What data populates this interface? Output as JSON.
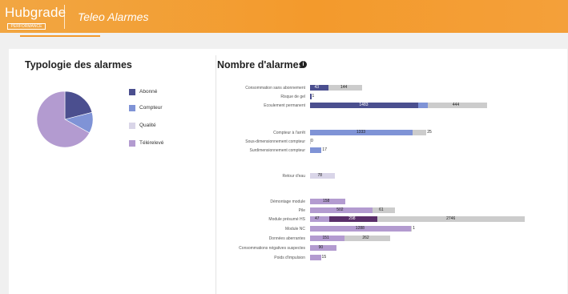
{
  "header": {
    "logo_text": "Hubgrade",
    "logo_subtitle": "PERFORMANCE",
    "app_title": "Teleo Alarmes"
  },
  "typology": {
    "title": "Typologie des alarmes",
    "legend": [
      {
        "label": "Abonné",
        "color": "#4b4f8f"
      },
      {
        "label": "Compteur",
        "color": "#7f93d6"
      },
      {
        "label": "Qualité",
        "color": "#d9d5e8"
      },
      {
        "label": "Télérelevé",
        "color": "#b39bd0"
      }
    ],
    "slices": [
      {
        "label": "Abonné",
        "share": 0.21
      },
      {
        "label": "Compteur",
        "share": 0.12
      },
      {
        "label": "Télérelevé",
        "share": 0.67
      }
    ]
  },
  "counts": {
    "title": "Nombre d'alarmes",
    "info_icon": "info-icon",
    "rows": [
      {
        "label": "Consommation sans abonnement",
        "group": "abonne",
        "segments": [
          {
            "v": "43",
            "n": 43,
            "c": "#4b4f8f"
          },
          {
            "v": "144",
            "n": 144,
            "c": "#cccccc"
          }
        ]
      },
      {
        "label": "Risque de gel",
        "group": "abonne",
        "segments": [
          {
            "v": "1",
            "n": 1,
            "c": "#4b4f8f"
          }
        ]
      },
      {
        "label": "Ecoulement permanent",
        "group": "abonne",
        "segments": [
          {
            "v": "1483",
            "n": 1483,
            "c": "#4b4f8f"
          },
          {
            "v": "12",
            "n": 12,
            "c": "#7f93d6"
          },
          {
            "v": "444",
            "n": 444,
            "c": "#cccccc"
          }
        ]
      },
      {
        "label": "Compteur à l'arrêt",
        "group": "compteur",
        "segments": [
          {
            "v": "1333",
            "n": 1333,
            "c": "#7f93d6"
          },
          {
            "v": "25",
            "n": 25,
            "c": "#cccccc"
          }
        ]
      },
      {
        "label": "Sous-dimensionnement compteur",
        "group": "compteur",
        "segments": [
          {
            "v": "0",
            "n": 0,
            "c": "#7f93d6"
          }
        ]
      },
      {
        "label": "Surdimensionnement compteur",
        "group": "compteur",
        "segments": [
          {
            "v": "17",
            "n": 17,
            "c": "#7f93d6"
          }
        ]
      },
      {
        "label": "Retour d'eau",
        "group": "qualite",
        "segments": [
          {
            "v": "78",
            "n": 78,
            "c": "#d9d5e8"
          }
        ]
      },
      {
        "label": "Démontage module",
        "group": "telereleve",
        "segments": [
          {
            "v": "158",
            "n": 158,
            "c": "#b39bd0"
          }
        ]
      },
      {
        "label": "Pile",
        "group": "telereleve",
        "segments": [
          {
            "v": "502",
            "n": 502,
            "c": "#b39bd0"
          },
          {
            "v": "61",
            "n": 61,
            "c": "#cccccc"
          }
        ]
      },
      {
        "label": "Module présumé HS",
        "group": "telereleve",
        "segments": [
          {
            "v": "47",
            "n": 47,
            "c": "#b39bd0"
          },
          {
            "v": "298",
            "n": 298,
            "c": "#5a2f6a"
          },
          {
            "v": "2746",
            "n": 2746,
            "c": "#cccccc"
          }
        ]
      },
      {
        "label": "Module NC",
        "group": "telereleve",
        "segments": [
          {
            "v": "1288",
            "n": 1288,
            "c": "#b39bd0"
          },
          {
            "v": "1",
            "n": 1,
            "c": "#cccccc"
          }
        ]
      },
      {
        "label": "Données aberrantes",
        "group": "telereleve",
        "segments": [
          {
            "v": "151",
            "n": 151,
            "c": "#b39bd0"
          },
          {
            "v": "262",
            "n": 262,
            "c": "#cccccc"
          }
        ]
      },
      {
        "label": "Consommations négatives suspectes",
        "group": "telereleve",
        "segments": [
          {
            "v": "90",
            "n": 90,
            "c": "#b39bd0"
          }
        ]
      },
      {
        "label": "Poids d'impulsion",
        "group": "telereleve",
        "segments": [
          {
            "v": "15",
            "n": 15,
            "c": "#b39bd0"
          }
        ]
      }
    ]
  }
}
